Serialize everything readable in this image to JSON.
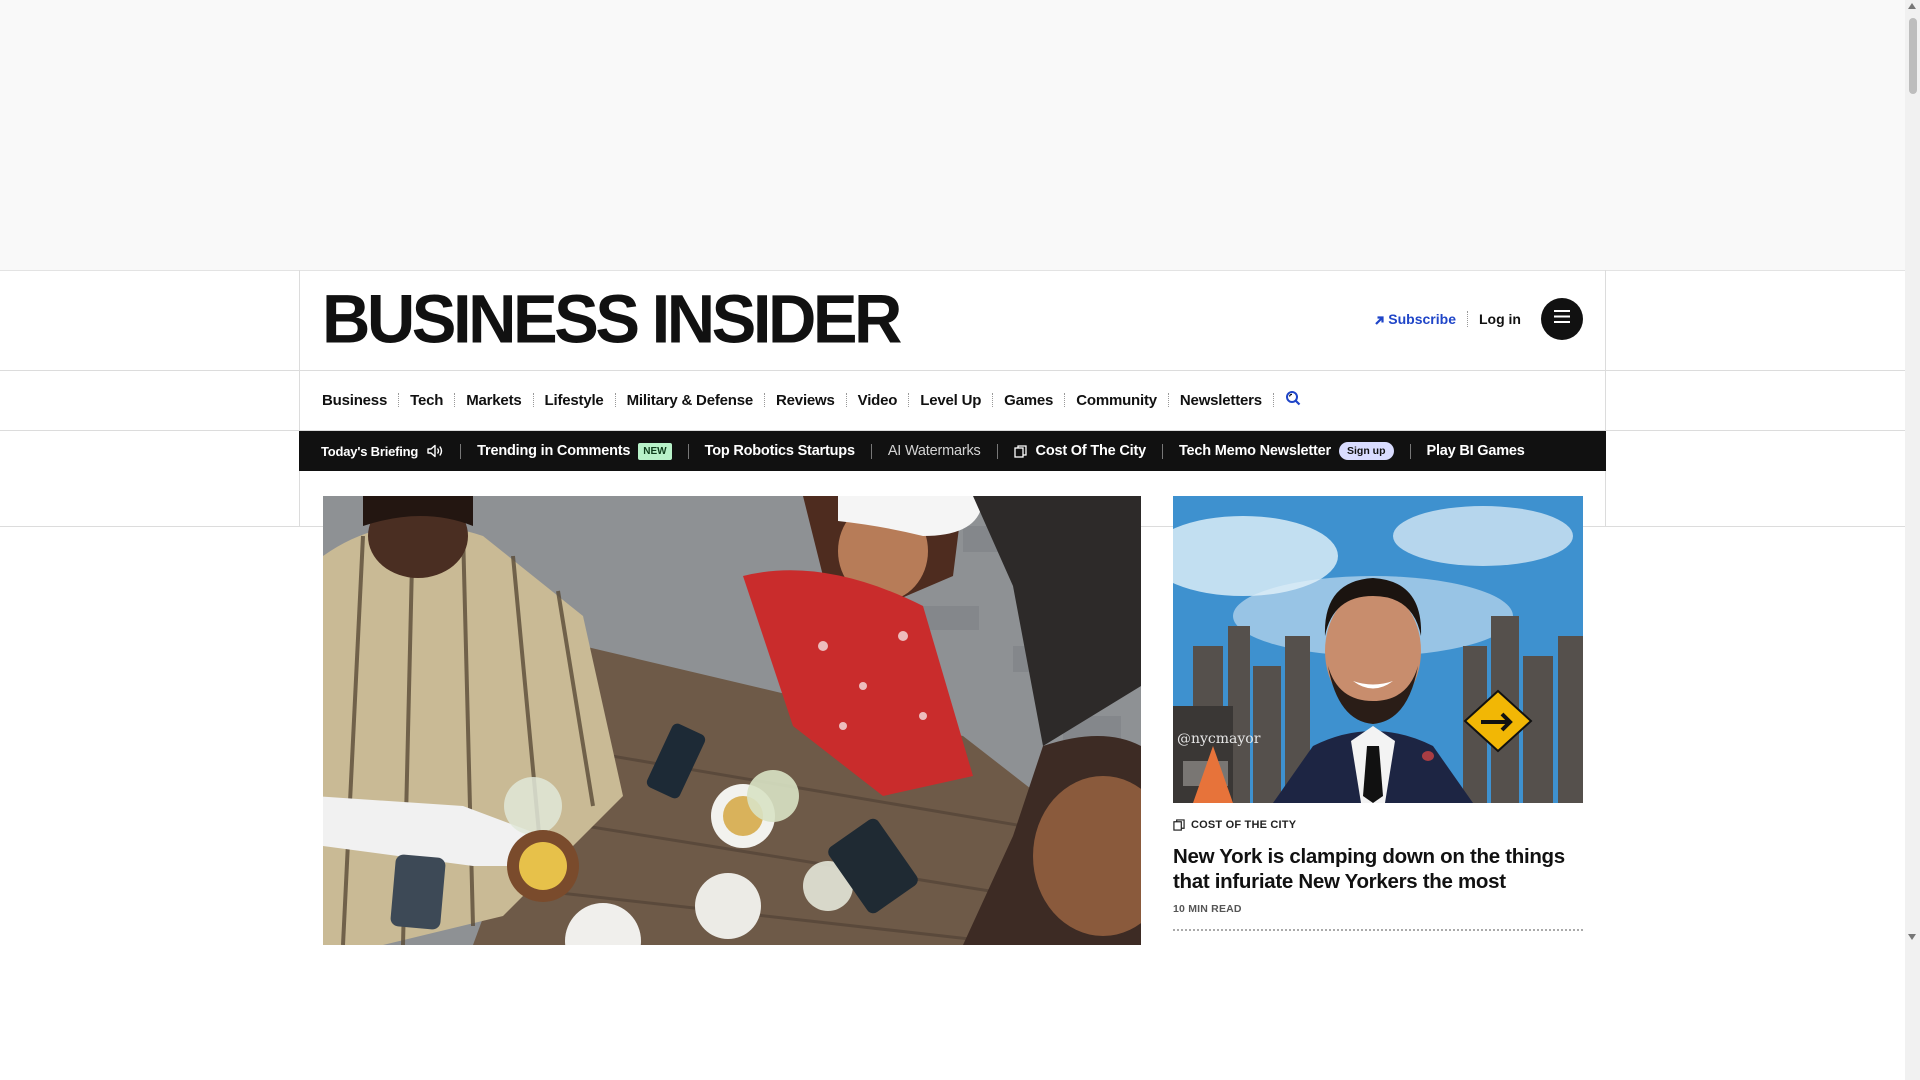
{
  "header": {
    "logo": "BUSINESS INSIDER",
    "subscribe_label": "Subscribe",
    "login_label": "Log in",
    "menu_icon": "hamburger-menu-icon",
    "accent_color": "#1f45c8"
  },
  "nav": {
    "items": [
      "Business",
      "Tech",
      "Markets",
      "Lifestyle",
      "Military & Defense",
      "Reviews",
      "Video",
      "Level Up",
      "Games",
      "Community",
      "Newsletters"
    ],
    "search_icon": "search-icon"
  },
  "briefing": {
    "label": "Today's Briefing",
    "speaker_icon": "speaker-icon",
    "trending_label": "Trending in Comments",
    "new_badge": "NEW",
    "robotics_label": "Top Robotics Startups",
    "watermarks_label": "AI Watermarks",
    "city_label": "Cost Of The City",
    "memo_label": "Tech Memo Newsletter",
    "signup_badge": "Sign up",
    "games_label": "Play BI Games"
  },
  "side_story": {
    "kicker": "COST OF THE CITY",
    "headline": "New York is clamping down on the things that infuriate New Yorkers the most",
    "read_time": "10 MIN READ",
    "photo_watermark": "@nycmayor"
  }
}
